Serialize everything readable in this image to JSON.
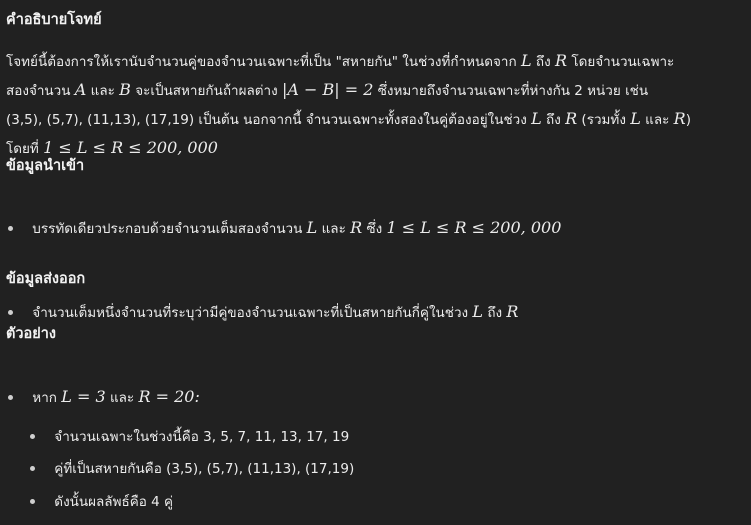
{
  "description": {
    "heading": "คำอธิบายโจทย์",
    "line1_a": "โจทย์นี้ต้องการให้เรานับจำนวนคู่ของจำนวนเฉพาะที่เป็น \"สหายกัน\" ในช่วงที่กำหนดจาก",
    "line1_L": "L",
    "line1_b": "ถึง",
    "line1_R": "R",
    "line1_c": "โดยจำนวนเฉพาะ",
    "line2_a": "สองจำนวน",
    "line2_A": "A",
    "line2_b": "และ",
    "line2_B": "B",
    "line2_c": "จะเป็นสหายกันถ้าผลต่าง",
    "line2_expr": "|A − B| = 2",
    "line2_d": "ซึ่งหมายถึงจำนวนเฉพาะที่ห่างกัน 2 หน่วย เช่น",
    "line3_a": "(3,5), (5,7), (11,13), (17,19) เป็นต้น นอกจากนี้ จำนวนเฉพาะทั้งสองในคู่ต้องอยู่ในช่วง",
    "line3_L": "L",
    "line3_b": "ถึง",
    "line3_R": "R",
    "line3_c": "(รวมทั้ง",
    "line3_L2": "L",
    "line3_d": "และ",
    "line3_R2": "R",
    "line3_e": ")",
    "line4_a": "โดยที่",
    "line4_expr": "1 ≤ L ≤ R ≤ 200, 000"
  },
  "input": {
    "heading": "ข้อมูลนำเข้า",
    "item_a": "บรรทัดเดียวประกอบด้วยจำนวนเต็มสองจำนวน",
    "item_L": "L",
    "item_b": "และ",
    "item_R": "R",
    "item_c": "ซึ่ง",
    "item_expr": "1 ≤ L ≤ R ≤ 200, 000"
  },
  "output": {
    "heading": "ข้อมูลส่งออก",
    "item_a": "จำนวนเต็มหนึ่งจำนวนที่ระบุว่ามีคู่ของจำนวนเฉพาะที่เป็นสหายกันกี่คู่ในช่วง",
    "item_L": "L",
    "item_b": "ถึง",
    "item_R": "R"
  },
  "example": {
    "heading": "ตัวอย่าง",
    "item_a": "หาก",
    "item_expr1": "L = 3",
    "item_b": "และ",
    "item_expr2": "R = 20:",
    "sub1": "จำนวนเฉพาะในช่วงนี้คือ 3, 5, 7, 11, 13, 17, 19",
    "sub2": "คู่ที่เป็นสหายกันคือ (3,5), (5,7), (11,13), (17,19)",
    "sub3": "ดังนั้นผลลัพธ์คือ 4 คู่"
  }
}
